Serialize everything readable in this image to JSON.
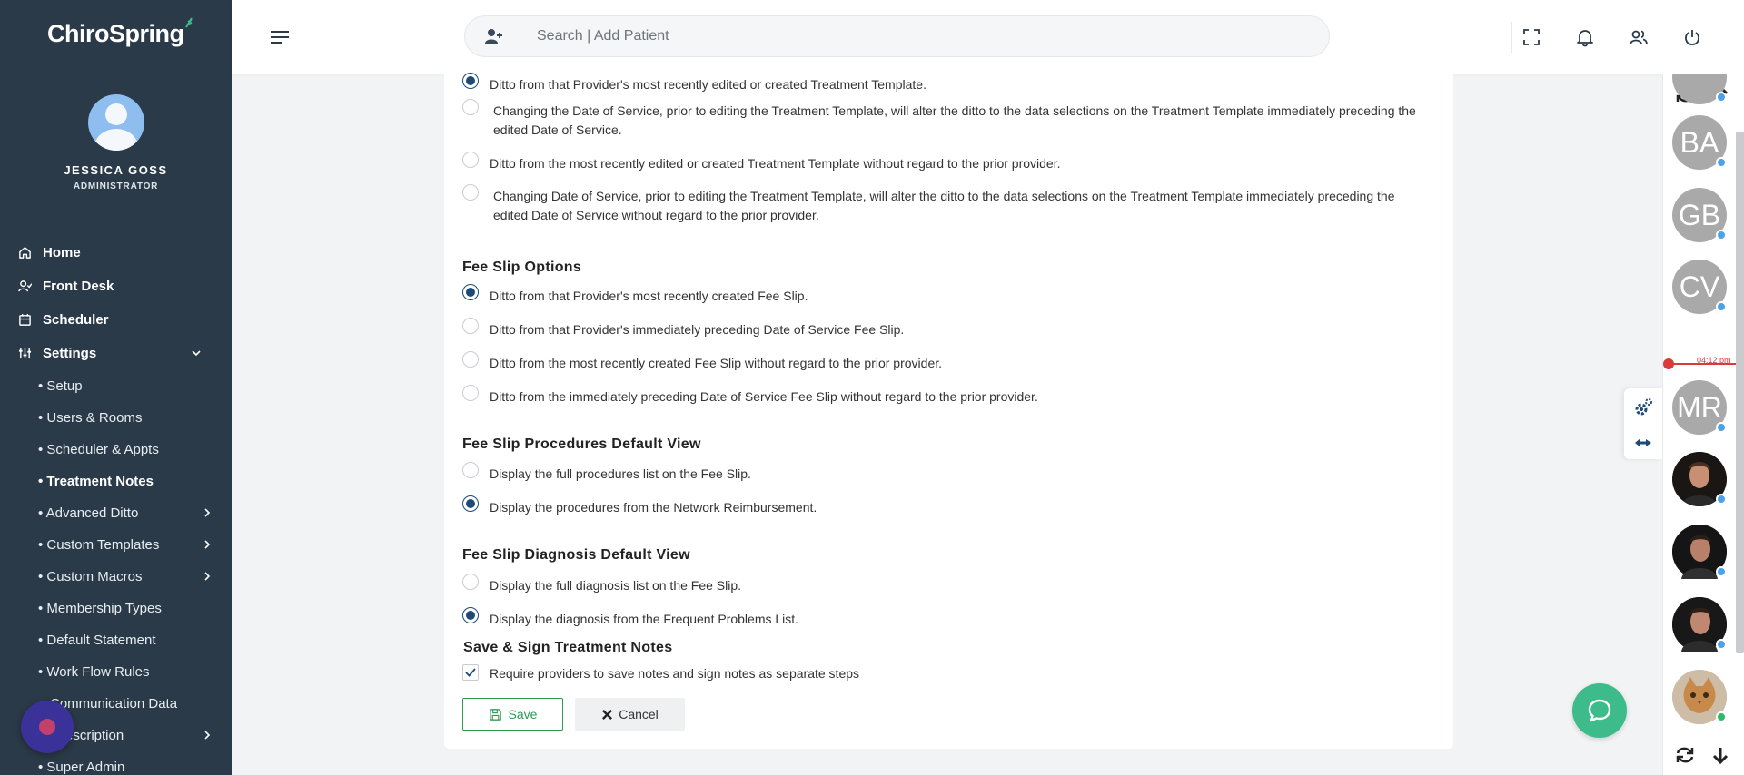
{
  "app": {
    "brand": "ChiroSpring"
  },
  "user": {
    "name": "JESSICA GOSS",
    "role": "ADMINISTRATOR"
  },
  "nav": {
    "home": "Home",
    "front_desk": "Front Desk",
    "scheduler": "Scheduler",
    "settings": "Settings",
    "sub_items": [
      "• Setup",
      "• Users & Rooms",
      "• Scheduler & Appts",
      "• Treatment Notes",
      "• Advanced Ditto",
      "• Custom Templates",
      "• Custom Macros",
      "• Membership Types",
      "• Default Statement",
      "• Work Flow Rules",
      "Communication Data",
      "escription",
      "• Super Admin"
    ],
    "active_sub": "• Treatment Notes"
  },
  "search": {
    "placeholder": "Search | Add Patient"
  },
  "treatment_template": {
    "options": [
      "Ditto from that Provider's most recently edited or created Treatment Template.",
      "Changing the Date of Service, prior to editing the Treatment Template, will alter the ditto to the data selections on the Treatment Template immediately preceding the edited Date of Service.",
      "Ditto from the most recently edited or created Treatment Template without regard to the prior provider.",
      "Changing Date of Service, prior to editing the Treatment Template, will alter the ditto to the data selections on the Treatment Template immediately preceding the edited Date of Service without regard to the prior provider."
    ],
    "selected": 0
  },
  "fee_slip_options": {
    "title": "Fee Slip Options",
    "options": [
      "Ditto from that Provider's most recently created Fee Slip.",
      "Ditto from that Provider's immediately preceding Date of Service Fee Slip.",
      "Ditto from the most recently created Fee Slip without regard to the prior provider.",
      "Ditto from the immediately preceding Date of Service Fee Slip without regard to the prior provider."
    ],
    "selected": 0
  },
  "procedures_view": {
    "title": "Fee Slip Procedures Default View",
    "options": [
      "Display the full procedures list on the Fee Slip.",
      "Display the procedures from the Network Reimbursement."
    ],
    "selected": 1
  },
  "diagnosis_view": {
    "title": "Fee Slip Diagnosis Default View",
    "options": [
      "Display the full diagnosis list on the Fee Slip.",
      "Display the diagnosis from the Frequent Problems List."
    ],
    "selected": 1
  },
  "save_sign": {
    "title": "Save & Sign Treatment Notes",
    "checkbox_label": "Require providers to save notes and sign notes as separate steps",
    "checked": true
  },
  "buttons": {
    "save": "Save",
    "cancel": "Cancel"
  },
  "schedule": {
    "time_marker": "04:12 pm",
    "patients": [
      {
        "initials": "BA"
      },
      {
        "initials": "GB"
      },
      {
        "initials": "CV"
      },
      {
        "initials": "MR"
      }
    ]
  },
  "colors": {
    "sidebar": "#2b3a48",
    "radio_selected": "#1e4b75",
    "save_green": "#2e9a53",
    "chat_green": "#3dbb8a",
    "avatar_gray": "#a9a9a9",
    "status_blue": "#4aa3e8",
    "time_red": "#d93a3a"
  }
}
